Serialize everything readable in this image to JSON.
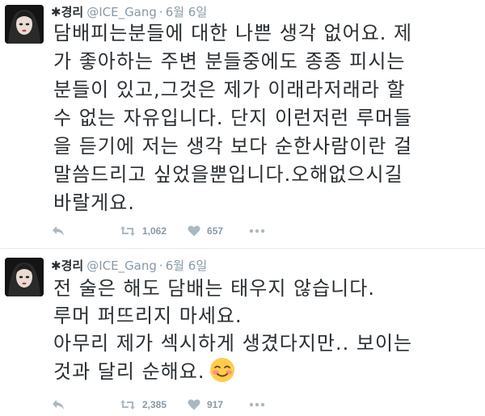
{
  "tweets": [
    {
      "name": "경리",
      "handle": "@ICE_Gang",
      "dot": "·",
      "date": "6월 6일",
      "text_lines": [
        "담배피는분들에 대한 나쁜 생각 없어요. 제",
        "가 좋아하는 주변 분들중에도 종종 피시는",
        "분들이 있고,그것은 제가 이래라저래라 할",
        "수 없는 자유입니다. 단지 이런저런 루머들",
        "을 듣기에 저는 생각 보다 순한사람이란 걸",
        "말씀드리고 싶었을뿐입니다.오해없으시길",
        "바랄게요."
      ],
      "retweets": "1,062",
      "likes": "657"
    },
    {
      "name": "경리",
      "handle": "@ICE_Gang",
      "dot": "·",
      "date": "6월 6일",
      "text_lines": [
        "전 술은 해도 담배는 태우지 않습니다.",
        "루머 퍼뜨리지 마세요.",
        "아무리 제가 섹시하게 생겼다지만.. 보이는",
        "것과 달리 순해요."
      ],
      "emoji": "smiling-face-with-blush",
      "retweets": "2,385",
      "likes": "917"
    }
  ],
  "colors": {
    "text": "#292f33",
    "meta": "#8899a6",
    "divider": "#e1e8ed"
  }
}
